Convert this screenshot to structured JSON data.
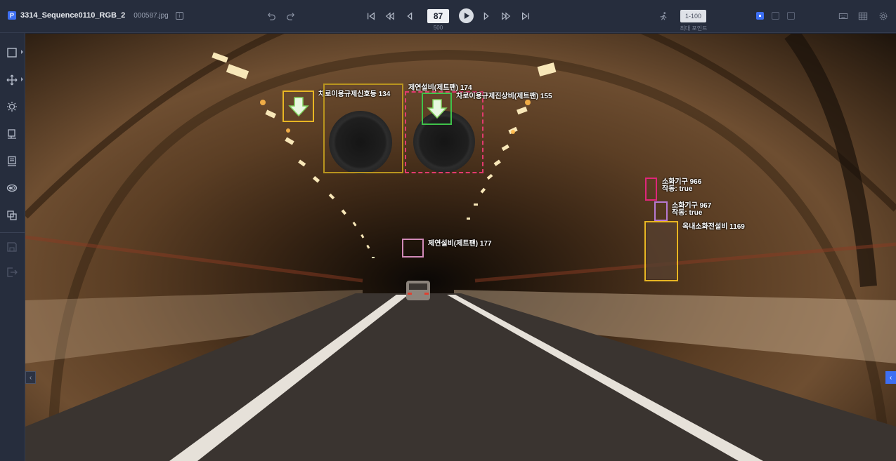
{
  "header": {
    "app_badge": "P",
    "sequence_name": "3314_Sequence0110_RGB_2",
    "file_name": "000587.jpg",
    "info_icon": "i",
    "current_frame": "87",
    "total_frames": "500",
    "points_value": "1-100",
    "points_label": "최대 포인트"
  },
  "icons": {
    "undo": "undo-icon",
    "redo": "redo-icon",
    "first": "skip-first-icon",
    "prev10": "rewind-icon",
    "prev": "prev-icon",
    "play": "play-icon",
    "next": "next-icon",
    "next10": "fast-forward-icon",
    "last": "skip-last-icon",
    "run": "running-person-icon",
    "settings": "gear-icon"
  },
  "sidebar": {
    "tools": [
      "bounding-box-tool",
      "move-tool",
      "brightness-tool",
      "tool-4",
      "tool-5",
      "toggle-visibility-tool",
      "layers-tool",
      "save",
      "exit"
    ]
  },
  "annotations": [
    {
      "label": "차로이용규제신호등 134",
      "color": "#e8b623"
    },
    {
      "label": "제연설비(제트팬) 174",
      "color": "#b8941e"
    },
    {
      "label": "차로이용규제진상비(제트팬) 155",
      "color": "#e23a6e"
    },
    {
      "label": "제연설비(제트팬) 177",
      "color": "#d18ab8"
    },
    {
      "label": "소화기구 966",
      "sub": "작동: true",
      "color": "#e0267a"
    },
    {
      "label": "소화기구 967",
      "sub": "작동: true",
      "color": "#b779d2"
    },
    {
      "label": "옥내소화전설비 1169",
      "color": "#e8b623"
    },
    {
      "label": "",
      "color": "#3fc24a"
    }
  ],
  "colors": {
    "accent": "#3d6ff3",
    "topbar": "#262d3d",
    "sidebar": "#262d3d"
  }
}
